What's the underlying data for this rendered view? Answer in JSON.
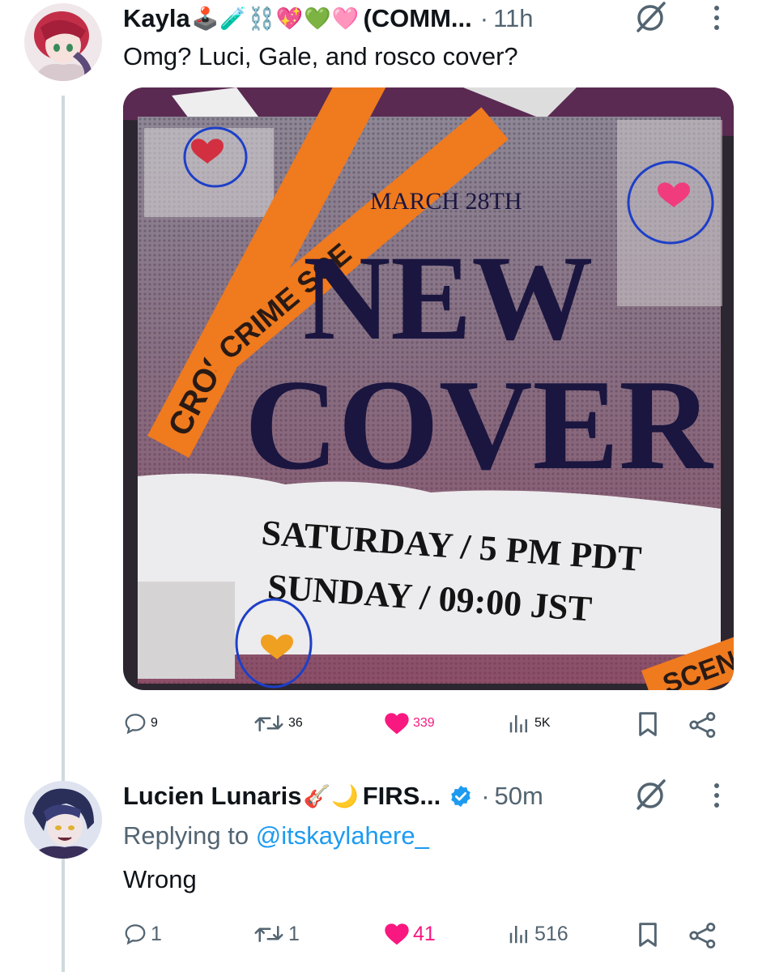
{
  "tweet1": {
    "name": "Kayla",
    "emojis": "🕹️🧪⛓️💖💚🩷",
    "handle_suffix": "(COMM...",
    "sep": "·",
    "time": "11h",
    "text": "Omg? Luci, Gale, and rosco cover?",
    "media": {
      "tape_top_1": "CRIME SCE",
      "tape_top_2": "CRIM",
      "tape_left": "CROSS",
      "tape_left_2": "T CRO",
      "date": "MARCH 28TH",
      "headline_1": "NEW",
      "headline_2": "COVER",
      "line_1": "SATURDAY / 5 PM PDT",
      "line_2": "SUNDAY / 09:00 JST",
      "tape_bottom": "SCENE"
    },
    "stats": {
      "replies": "9",
      "reposts": "36",
      "likes": "339",
      "views": "5K"
    }
  },
  "tweet2": {
    "name": "Lucien Lunaris",
    "emojis": "🎸🌙",
    "handle_suffix": "FIRS...",
    "sep": "·",
    "time": "50m",
    "replying_prefix": "Replying to",
    "replying_handle": "@itskaylahere_",
    "text": "Wrong",
    "stats": {
      "replies": "1",
      "reposts": "1",
      "likes": "41",
      "views": "516"
    }
  },
  "colors": {
    "accent": "#1d9bf0",
    "like": "#f91880",
    "muted": "#536471",
    "tape": "#f07a1e"
  }
}
